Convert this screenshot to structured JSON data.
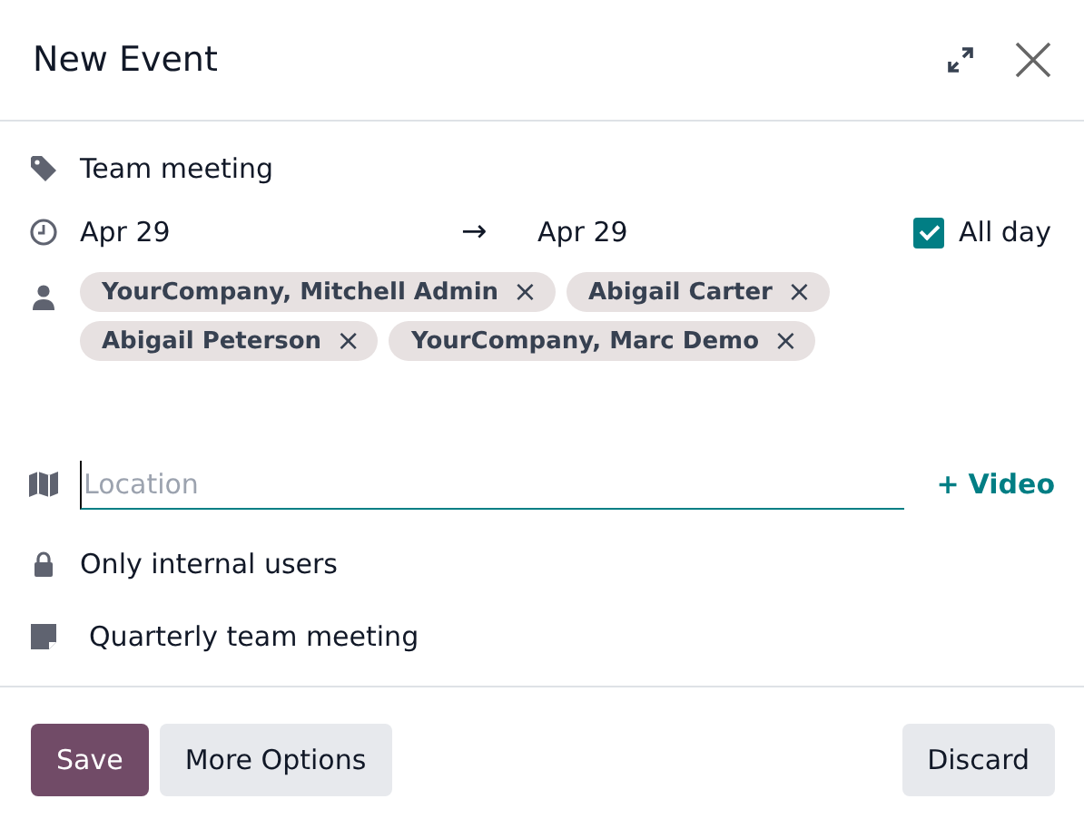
{
  "dialog": {
    "title": "New Event"
  },
  "event": {
    "name": "Team meeting",
    "start": "Apr 29",
    "arrow": "→",
    "stop": "Apr 29",
    "all_day": {
      "label": "All day",
      "checked": true
    },
    "attendees": [
      {
        "name": "YourCompany, Mitchell Admin",
        "remove": "×"
      },
      {
        "name": "Abigail Carter",
        "remove": "×"
      },
      {
        "name": "Abigail Peterson",
        "remove": "×"
      },
      {
        "name": "YourCompany, Marc Demo",
        "remove": "×"
      }
    ],
    "location": {
      "placeholder": "Location"
    },
    "video": {
      "icon": "+",
      "label": "Video"
    },
    "privacy": "Only internal users",
    "description": "Quarterly team meeting"
  },
  "buttons": [
    {
      "label": "Save",
      "kind": "primary"
    },
    {
      "label": "More Options",
      "kind": "secondary"
    },
    {
      "label": "Discard",
      "kind": "secondary"
    }
  ]
}
